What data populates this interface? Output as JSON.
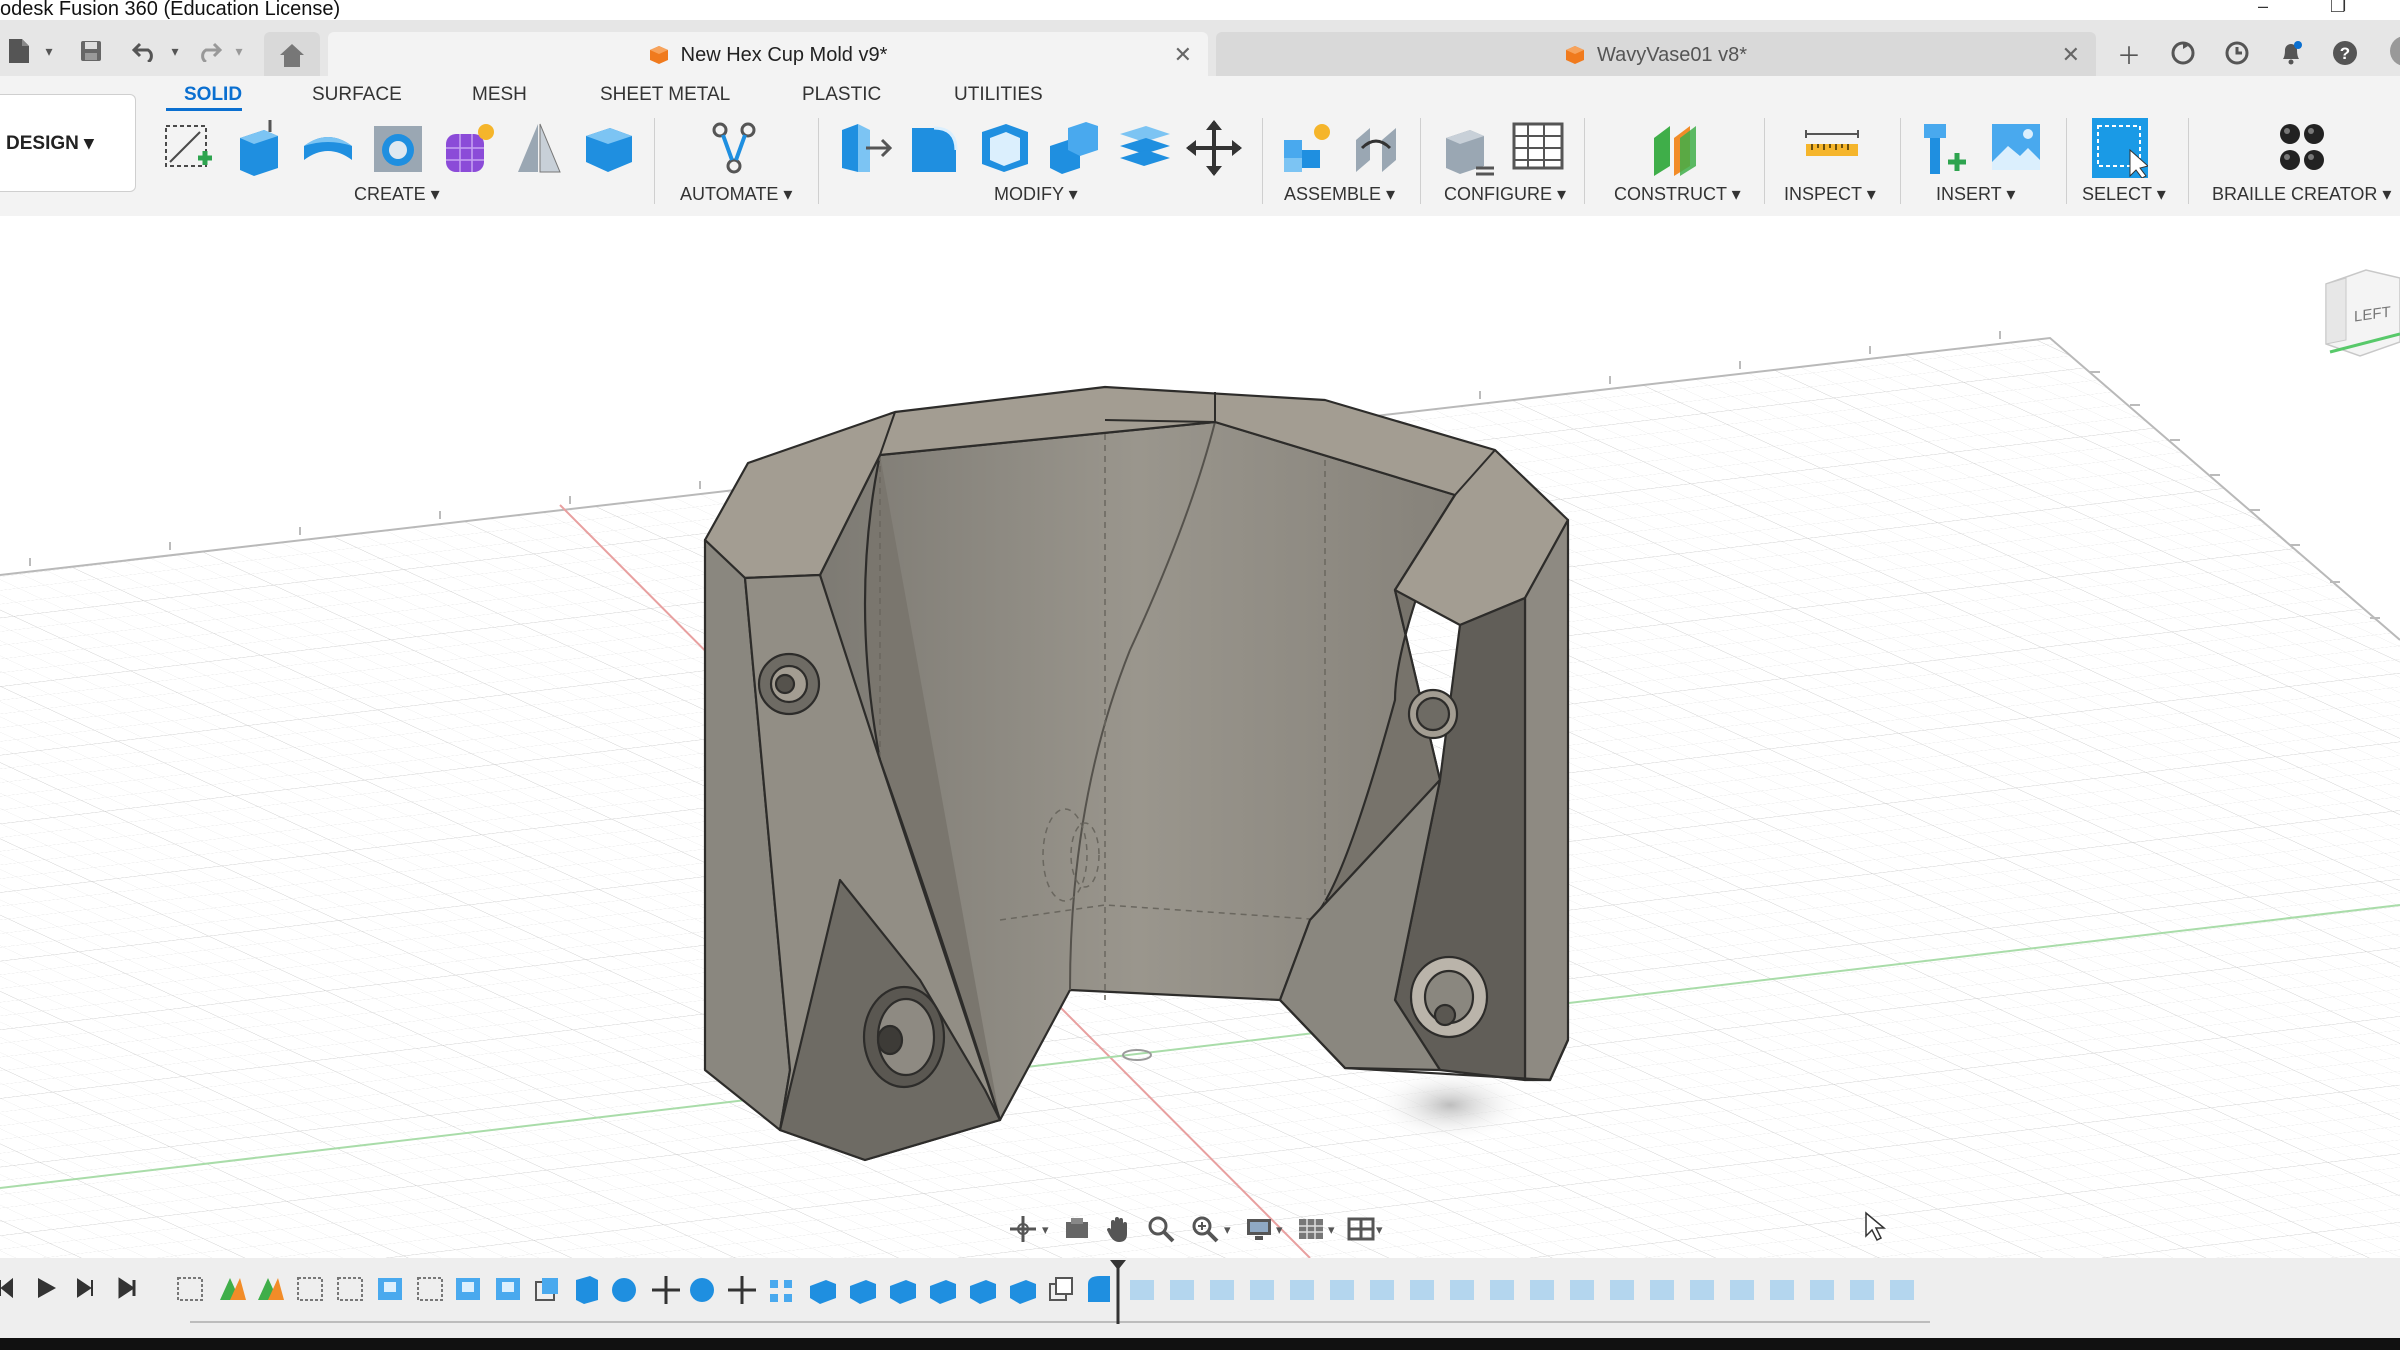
{
  "window": {
    "title": "odesk Fusion 360 (Education License)",
    "minimize_glyph": "–",
    "restore_glyph": "❐"
  },
  "tabs": [
    {
      "label": "New Hex Cup Mold v9*",
      "active": true
    },
    {
      "label": "WavyVase01 v8*",
      "active": false
    }
  ],
  "workspace": {
    "label": "DESIGN ▾"
  },
  "ribbon_tabs": [
    "SOLID",
    "SURFACE",
    "MESH",
    "SHEET METAL",
    "PLASTIC",
    "UTILITIES"
  ],
  "groups": {
    "create": "CREATE ▾",
    "automate": "AUTOMATE ▾",
    "modify": "MODIFY ▾",
    "assemble": "ASSEMBLE ▾",
    "configure": "CONFIGURE ▾",
    "construct": "CONSTRUCT ▾",
    "inspect": "INSPECT ▾",
    "insert": "INSERT ▾",
    "select": "SELECT ▾",
    "braille": "BRAILLE CREATOR ▾"
  },
  "viewcube": {
    "face_label": "LEFT"
  },
  "icons": {
    "file": "file-icon",
    "save": "save-icon",
    "undo": "undo-icon",
    "redo": "redo-icon",
    "home": "home-icon",
    "add_tab": "plus-icon",
    "sync": "sync-icon",
    "history": "clock-icon",
    "notify": "bell-icon",
    "help": "help-icon"
  },
  "colors": {
    "accent": "#0a6fd0",
    "model_face": "#8a877f",
    "model_top": "#a39d92",
    "tab_active_bg": "#f3f3f3",
    "tab_inactive_bg": "#d9d9d9"
  }
}
